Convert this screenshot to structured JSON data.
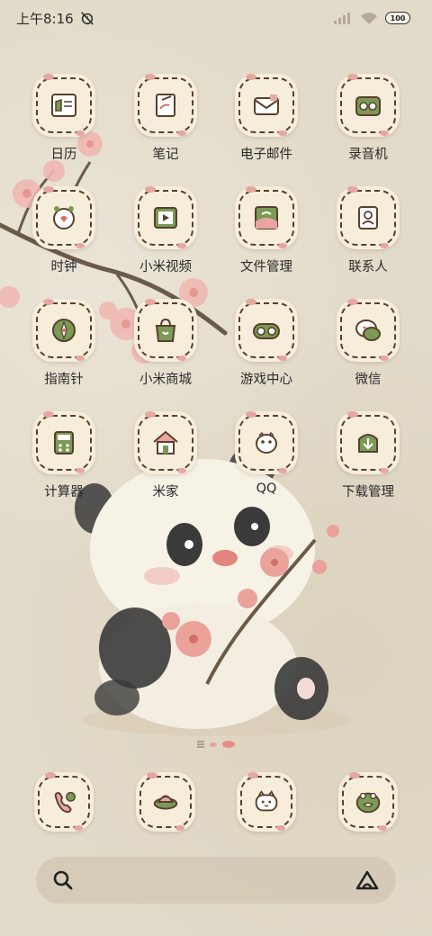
{
  "status_bar": {
    "time": "上午8:16",
    "battery": "100",
    "icons": [
      "alarm-off-icon",
      "signal-icon",
      "wifi-icon",
      "battery-icon"
    ]
  },
  "apps": [
    {
      "label": "日历",
      "icon": "calendar-icon"
    },
    {
      "label": "笔记",
      "icon": "notes-icon"
    },
    {
      "label": "电子邮件",
      "icon": "email-icon"
    },
    {
      "label": "录音机",
      "icon": "recorder-icon"
    },
    {
      "label": "时钟",
      "icon": "clock-icon"
    },
    {
      "label": "小米视频",
      "icon": "video-icon"
    },
    {
      "label": "文件管理",
      "icon": "file-manager-icon"
    },
    {
      "label": "联系人",
      "icon": "contacts-icon"
    },
    {
      "label": "指南针",
      "icon": "compass-icon"
    },
    {
      "label": "小米商城",
      "icon": "shopping-bag-icon"
    },
    {
      "label": "游戏中心",
      "icon": "gamepad-icon"
    },
    {
      "label": "微信",
      "icon": "wechat-icon"
    },
    {
      "label": "计算器",
      "icon": "calculator-icon"
    },
    {
      "label": "米家",
      "icon": "home-icon"
    },
    {
      "label": "QQ",
      "icon": "qq-icon"
    },
    {
      "label": "下载管理",
      "icon": "download-icon"
    }
  ],
  "dock": [
    {
      "icon": "phone-icon"
    },
    {
      "icon": "messages-icon"
    },
    {
      "icon": "browser-icon"
    },
    {
      "icon": "camera-icon"
    }
  ],
  "search": {
    "icons": [
      "search-icon",
      "assistant-icon"
    ]
  },
  "colors": {
    "background": "#e3dbc9",
    "icon_bg": "#f6eedb",
    "accent_green": "#7a9a55",
    "blossom": "#e7a6a2",
    "outline": "#5a3f2c"
  }
}
